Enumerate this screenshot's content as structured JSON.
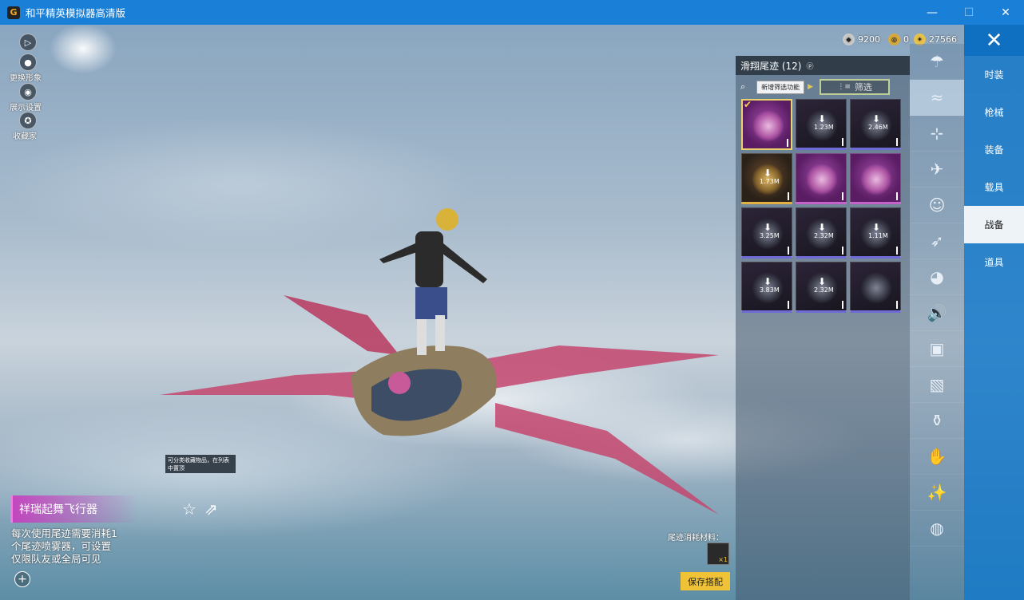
{
  "window": {
    "title": "和平精英模拟器高清版",
    "logo": "G",
    "minimize": "—",
    "maximize": "☐",
    "close": "✕"
  },
  "left_menu": [
    {
      "icon": "play-icon",
      "glyph": "▷",
      "label": ""
    },
    {
      "icon": "avatar-icon",
      "glyph": "●",
      "label": "更换形象"
    },
    {
      "icon": "eye-icon",
      "glyph": "◉",
      "label": "展示设置"
    },
    {
      "icon": "collection-icon",
      "glyph": "✪",
      "label": "收藏家"
    }
  ],
  "currency": [
    {
      "icon": "silver-coin-icon",
      "value": "9200",
      "color": "#c9c9c9"
    },
    {
      "icon": "gold-coupon-icon",
      "value": "0",
      "color": "#d9a93b"
    },
    {
      "icon": "gold-coin-icon",
      "value": "27566",
      "color": "#e7c14a"
    }
  ],
  "panel": {
    "title": "滑翔尾迹 (12)",
    "new_filter": "新增筛选功能",
    "filter": "筛选",
    "items": [
      {
        "state": "owned",
        "style": "purple",
        "size": "",
        "selected": true
      },
      {
        "state": "download",
        "style": "dark",
        "size": "1.23M",
        "selected": false
      },
      {
        "state": "download",
        "style": "dark",
        "size": "2.46M",
        "selected": false
      },
      {
        "state": "download",
        "style": "gold",
        "size": "1.73M",
        "selected": false
      },
      {
        "state": "owned",
        "style": "purple",
        "size": "",
        "selected": false
      },
      {
        "state": "owned",
        "style": "purple",
        "size": "",
        "selected": false
      },
      {
        "state": "download",
        "style": "dark",
        "size": "3.25M",
        "selected": false
      },
      {
        "state": "download",
        "style": "dark",
        "size": "2.32M",
        "selected": false
      },
      {
        "state": "download",
        "style": "dark",
        "size": "1.11M",
        "selected": false
      },
      {
        "state": "download",
        "style": "dark",
        "size": "3.83M",
        "selected": false
      },
      {
        "state": "download",
        "style": "dark",
        "size": "2.32M",
        "selected": false
      },
      {
        "state": "owned",
        "style": "dark",
        "size": "",
        "selected": false
      }
    ]
  },
  "categories": [
    {
      "icon": "parachute-icon",
      "glyph": "☂"
    },
    {
      "icon": "glider-trail-icon",
      "glyph": "≈",
      "active": true
    },
    {
      "icon": "drone-icon",
      "glyph": "⊹"
    },
    {
      "icon": "plane-icon",
      "glyph": "✈"
    },
    {
      "icon": "emote-icon",
      "glyph": "☺"
    },
    {
      "icon": "jet-icon",
      "glyph": "➶"
    },
    {
      "icon": "pet-icon",
      "glyph": "◕"
    },
    {
      "icon": "speaker-icon",
      "glyph": "🔊"
    },
    {
      "icon": "sticker-icon",
      "glyph": "▣"
    },
    {
      "icon": "photo-icon",
      "glyph": "▧"
    },
    {
      "icon": "grenade-icon",
      "glyph": "⚱"
    },
    {
      "icon": "hand-icon",
      "glyph": "✋"
    },
    {
      "icon": "sparkle-icon",
      "glyph": "✨"
    },
    {
      "icon": "ufo-icon",
      "glyph": "◍"
    }
  ],
  "tabs": [
    {
      "label": "时装",
      "active": false
    },
    {
      "label": "枪械",
      "active": false
    },
    {
      "label": "装备",
      "active": false
    },
    {
      "label": "载具",
      "active": false
    },
    {
      "label": "战备",
      "active": true
    },
    {
      "label": "道具",
      "active": false
    }
  ],
  "item": {
    "name": "祥瑞起舞飞行器",
    "desc_lines": [
      "每次使用尾迹需要消耗1",
      "个尾迹喷雾器，可设置",
      "仅限队友或全局可见"
    ],
    "tooltip": "可分类收藏物品，在列表中置顶"
  },
  "consume": {
    "label": "尾迹消耗材料：",
    "count": "×1"
  },
  "save_button": "保存搭配",
  "zoom": "+"
}
